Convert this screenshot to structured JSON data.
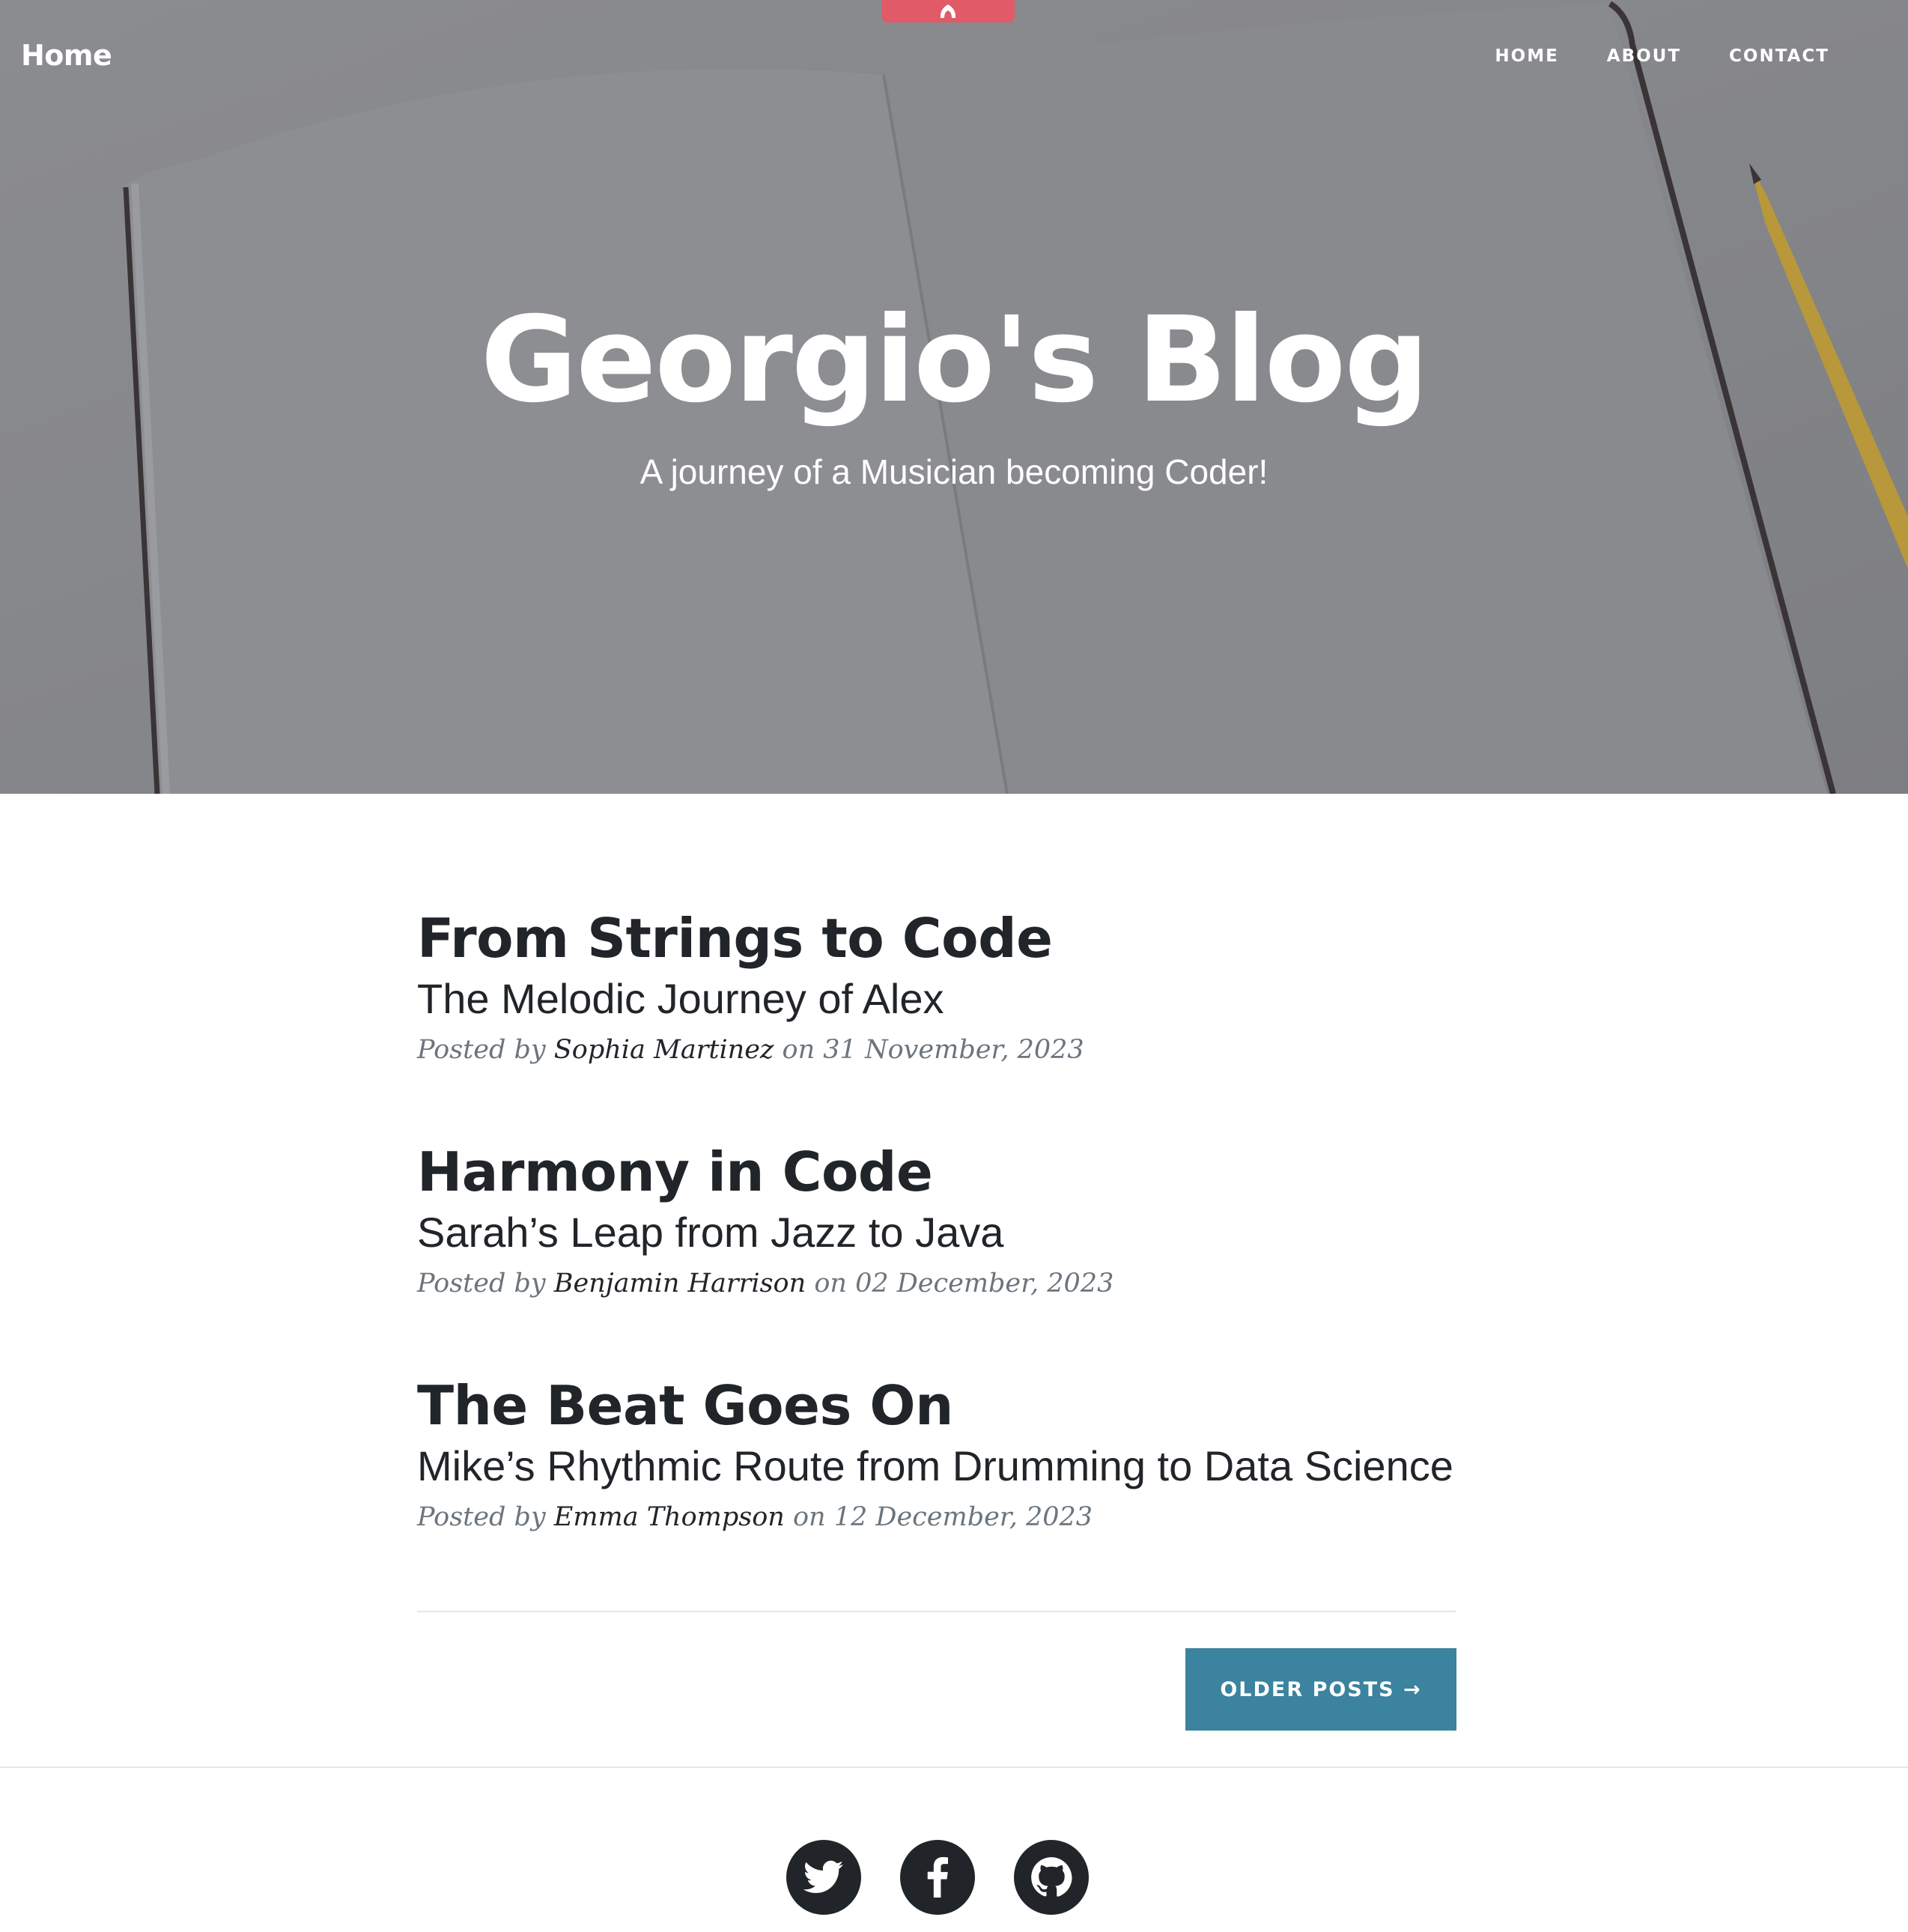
{
  "colors": {
    "hero_overlay": "#86878b",
    "badge": "#e15a68",
    "button": "#3b839e",
    "text_dark": "#212529",
    "text_muted": "#6c757d"
  },
  "top_badge": {
    "icon": "flame-icon"
  },
  "navbar": {
    "brand": "Home",
    "links": [
      {
        "label": "HOME"
      },
      {
        "label": "ABOUT"
      },
      {
        "label": "CONTACT"
      }
    ]
  },
  "hero": {
    "title": "Georgio's Blog",
    "subtitle": "A journey of a Musician becoming Coder!"
  },
  "posts": [
    {
      "title": "From Strings to Code",
      "subtitle": "The Melodic Journey of Alex",
      "posted_by": "Posted by",
      "author": "Sophia Martinez",
      "date_prefix": "on",
      "date": "31 November, 2023"
    },
    {
      "title": "Harmony in Code",
      "subtitle": "Sarah’s Leap from Jazz to Java",
      "posted_by": "Posted by",
      "author": "Benjamin Harrison",
      "date_prefix": "on",
      "date": "02 December, 2023"
    },
    {
      "title": "The Beat Goes On",
      "subtitle": "Mike’s Rhythmic Route from Drumming to Data Science",
      "posted_by": "Posted by",
      "author": "Emma Thompson",
      "date_prefix": "on",
      "date": "12 December, 2023"
    }
  ],
  "pagination": {
    "older_posts_label": "OLDER POSTS →"
  },
  "footer": {
    "social": [
      {
        "icon": "twitter-icon"
      },
      {
        "icon": "facebook-icon"
      },
      {
        "icon": "github-icon"
      }
    ]
  }
}
